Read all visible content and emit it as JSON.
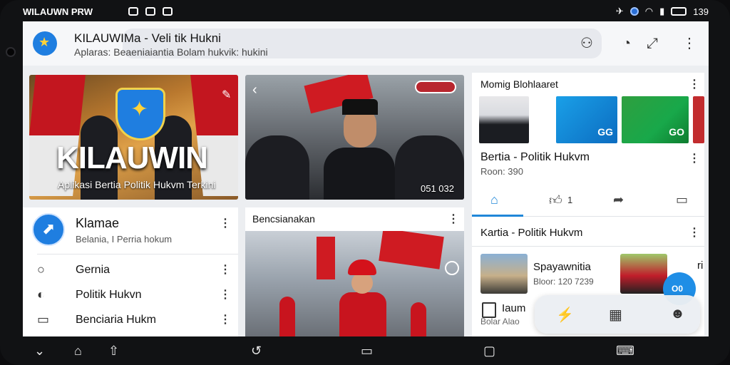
{
  "status_bar": {
    "left_text": "WILAUWN PRW",
    "right_text": "139"
  },
  "app": {
    "title": "KILAUWIMa - Veli tik Hukni",
    "subtitle": "Aplaras: Beaeniaiantia Bolam hukvik: hukini"
  },
  "hero": {
    "title": "KILAUWIN",
    "subtitle": "Aplikasi Bertia Politik Hukvm Terkini"
  },
  "news_photo": {
    "time": "051 032"
  },
  "right_panel": {
    "header": "Momig Blohlaaret",
    "thumbnails": [
      {
        "label": ""
      },
      {
        "label": "GG"
      },
      {
        "label": "GO"
      }
    ],
    "title": "Bertia - Politik Hukvm",
    "meta": "Roon: 390",
    "like_count": "1",
    "section_title": "Kartia - Politik Hukvm",
    "item": {
      "title": "Spayawnitia",
      "meta": "Bloor: 120 7239"
    },
    "item_extra": {
      "title": "Iaum",
      "meta": "Bolar Alao"
    },
    "edge_label": "ri"
  },
  "fab": {
    "label": "O0"
  },
  "menu_card": {
    "name": "Klamae",
    "subtitle": "Belania, I Perria hokum",
    "items": [
      {
        "label": "Gernia",
        "icon": "search-icon"
      },
      {
        "label": "Politik Hukvn",
        "icon": "toggle-icon"
      },
      {
        "label": "Benciaria Hukm",
        "icon": "card-icon"
      }
    ]
  },
  "event_card": {
    "title": "Bencsianakan"
  },
  "colors": {
    "accent": "#1f7ee0",
    "flag_red": "#c3161f"
  }
}
